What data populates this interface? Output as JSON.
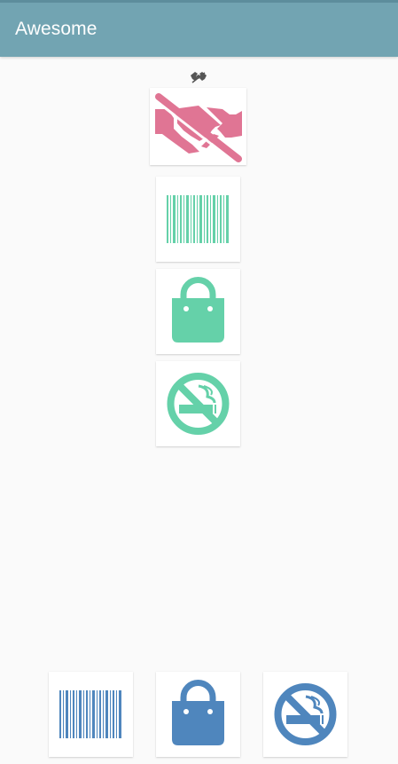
{
  "app_bar": {
    "title": "Awesome",
    "color": "#72a4b2"
  },
  "main": {
    "top_icon": "handshake-slash-icon",
    "featured_icon": "handshake-slash-icon",
    "featured_color": "#e07594",
    "list_icons": [
      "barcode-icon",
      "shopping-bag-icon",
      "no-smoking-icon"
    ],
    "list_color": "#65d1a9"
  },
  "bottom_row": {
    "icons": [
      "barcode-icon",
      "shopping-bag-icon",
      "no-smoking-icon"
    ],
    "color": "#4f86bd"
  }
}
